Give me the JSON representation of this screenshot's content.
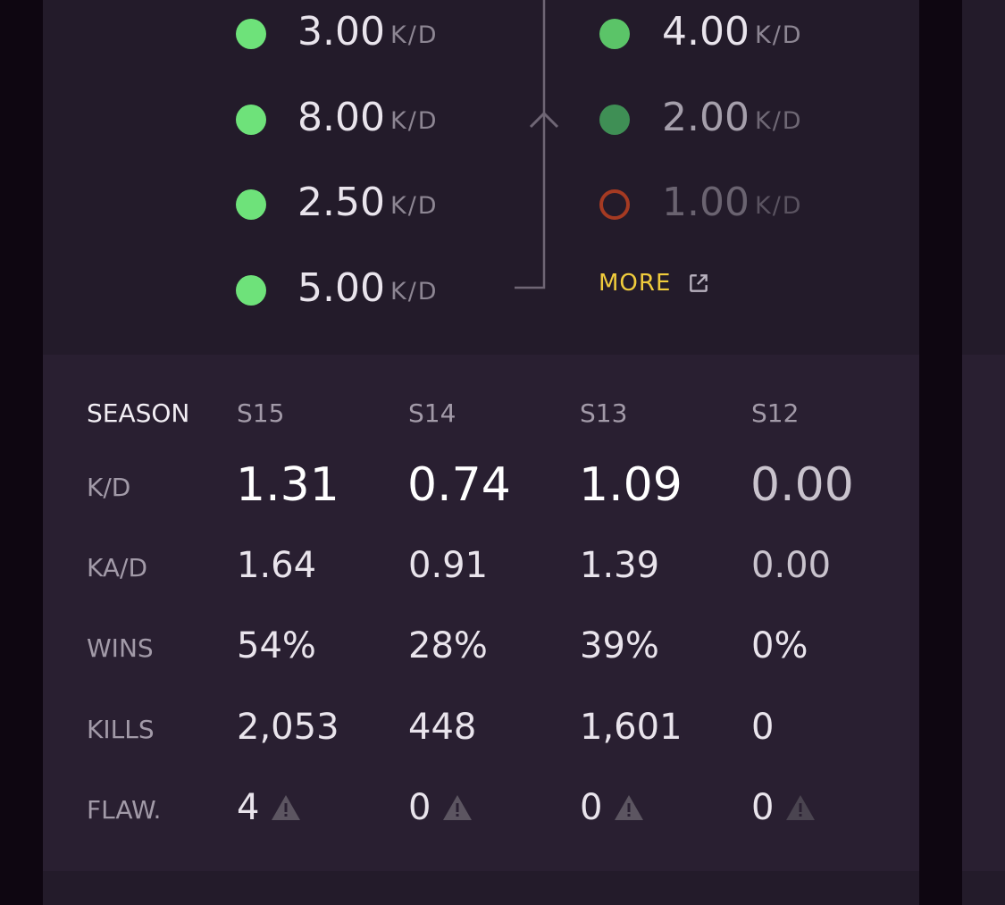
{
  "recent_matches": {
    "left_column": [
      {
        "value": "3.00",
        "unit": "K/D",
        "status": "win"
      },
      {
        "value": "8.00",
        "unit": "K/D",
        "status": "win"
      },
      {
        "value": "2.50",
        "unit": "K/D",
        "status": "win"
      },
      {
        "value": "5.00",
        "unit": "K/D",
        "status": "win"
      }
    ],
    "right_column": [
      {
        "value": "4.00",
        "unit": "K/D",
        "status": "win"
      },
      {
        "value": "2.00",
        "unit": "K/D",
        "status": "win-dim"
      },
      {
        "value": "1.00",
        "unit": "K/D",
        "status": "loss"
      }
    ],
    "more_label": "MORE",
    "more_icon": "external-link-icon",
    "colors": {
      "win": "#6ee27a",
      "win_dim": "#3f8f55",
      "loss": "#a53a22",
      "accent": "#f0cc3c"
    }
  },
  "season_stats": {
    "header_label": "SEASON",
    "seasons": [
      "S15",
      "S14",
      "S13",
      "S12"
    ],
    "rows": {
      "kd": {
        "label": "K/D",
        "values": [
          "1.31",
          "0.74",
          "1.09",
          "0.00"
        ]
      },
      "kad": {
        "label": "KA/D",
        "values": [
          "1.64",
          "0.91",
          "1.39",
          "0.00"
        ]
      },
      "wins": {
        "label": "WINS",
        "values": [
          "54%",
          "28%",
          "39%",
          "0%"
        ]
      },
      "kills": {
        "label": "KILLS",
        "values": [
          "2,053",
          "448",
          "1,601",
          "0"
        ]
      },
      "flawless": {
        "label": "FLAW.",
        "values": [
          "4",
          "0",
          "0",
          "0"
        ],
        "icon": "warning-icon"
      }
    }
  }
}
